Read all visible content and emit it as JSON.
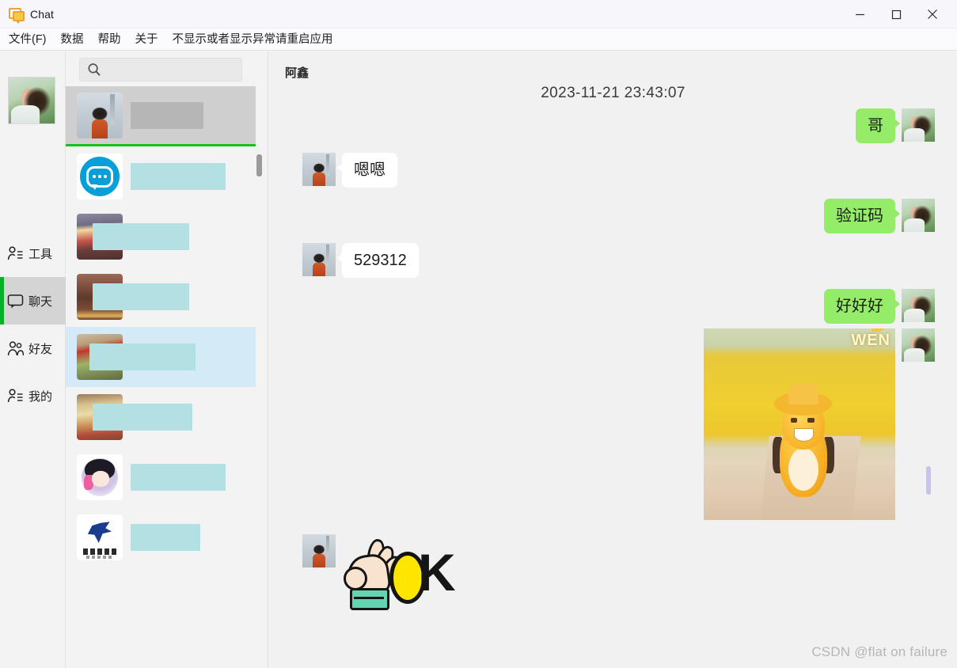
{
  "window": {
    "title": "Chat",
    "icon": "chat-bubble-icon",
    "controls": {
      "minimize": "minimize-icon",
      "maximize": "maximize-icon",
      "close": "close-icon"
    }
  },
  "menubar": {
    "items": [
      {
        "label": "文件(F)"
      },
      {
        "label": "数据"
      },
      {
        "label": "帮助"
      },
      {
        "label": "关于"
      },
      {
        "label": "不显示或者显示异常请重启应用"
      }
    ]
  },
  "rail": {
    "avatar": "user-avatar-photo",
    "items": [
      {
        "label": "工具",
        "icon": "tools-person-icon",
        "active": false
      },
      {
        "label": "聊天",
        "icon": "chat-icon",
        "active": true
      },
      {
        "label": "好友",
        "icon": "friends-icon",
        "active": false
      },
      {
        "label": "我的",
        "icon": "profile-icon",
        "active": false
      }
    ]
  },
  "search": {
    "value": "",
    "placeholder": "",
    "icon": "search-icon"
  },
  "chat_list": [
    {
      "avatar": "snow-photo",
      "name_redacted": true,
      "redact_color": "#b6b6b6",
      "redact_width": 92,
      "state": "selected"
    },
    {
      "avatar": "blue-chat-logo",
      "name_redacted": true,
      "redact_color": "#b3e0e3",
      "redact_width": 120,
      "state": "normal"
    },
    {
      "avatar": "food-photo-1",
      "name_redacted": true,
      "redact_color": "#b3e0e3",
      "redact_width": 122,
      "state": "normal"
    },
    {
      "avatar": "bear-photo",
      "name_redacted": true,
      "redact_color": "#b3e0e3",
      "redact_width": 122,
      "state": "normal"
    },
    {
      "avatar": "green-photo",
      "name_redacted": true,
      "redact_color": "#b3e0e3",
      "redact_width": 134,
      "state": "hover"
    },
    {
      "avatar": "food-photo-2",
      "name_redacted": true,
      "redact_color": "#b3e0e3",
      "redact_width": 126,
      "state": "normal"
    },
    {
      "avatar": "anime-girl-photo",
      "name_redacted": true,
      "redact_color": "#b3e0e3",
      "redact_width": 120,
      "state": "normal"
    },
    {
      "avatar": "company-logo",
      "name_redacted": true,
      "redact_color": "#b3e0e3",
      "redact_width": 88,
      "state": "normal"
    }
  ],
  "conversation": {
    "title": "阿鑫",
    "timestamp": "2023-11-21 23:43:07",
    "messages": [
      {
        "id": "m1",
        "side": "right",
        "type": "text",
        "text": "哥",
        "avatar": "user-avatar-photo"
      },
      {
        "id": "m2",
        "side": "left",
        "type": "text",
        "text": "嗯嗯",
        "avatar": "snow-photo"
      },
      {
        "id": "m3",
        "side": "right",
        "type": "text",
        "text": "验证码",
        "avatar": "user-avatar-photo"
      },
      {
        "id": "m4",
        "side": "left",
        "type": "text",
        "text": "529312",
        "avatar": "snow-photo"
      },
      {
        "id": "m5",
        "side": "right",
        "type": "text",
        "text": "好好好",
        "avatar": "user-avatar-photo"
      },
      {
        "id": "m6",
        "side": "right",
        "type": "image",
        "image": "yellow-cartoon-character-field",
        "watermark": "WEN",
        "avatar": "user-avatar-photo"
      },
      {
        "id": "m7",
        "side": "left",
        "type": "sticker",
        "sticker": "ok-hand-sticker",
        "sticker_text": "OK",
        "avatar": "snow-photo"
      }
    ]
  },
  "scrollbars": {
    "list_thumb": "list-scrollbar-thumb",
    "conv_thumb": "conversation-scrollbar-thumb"
  },
  "watermark": "CSDN @flat on failure",
  "colors": {
    "accent_green": "#06b025",
    "bubble_green": "#95ec69",
    "bubble_white": "#ffffff",
    "selected_gray": "#cfcfcf",
    "hover_blue": "#d4eaf7",
    "redact_teal": "#b3e0e3",
    "redact_gray": "#b6b6b6"
  }
}
